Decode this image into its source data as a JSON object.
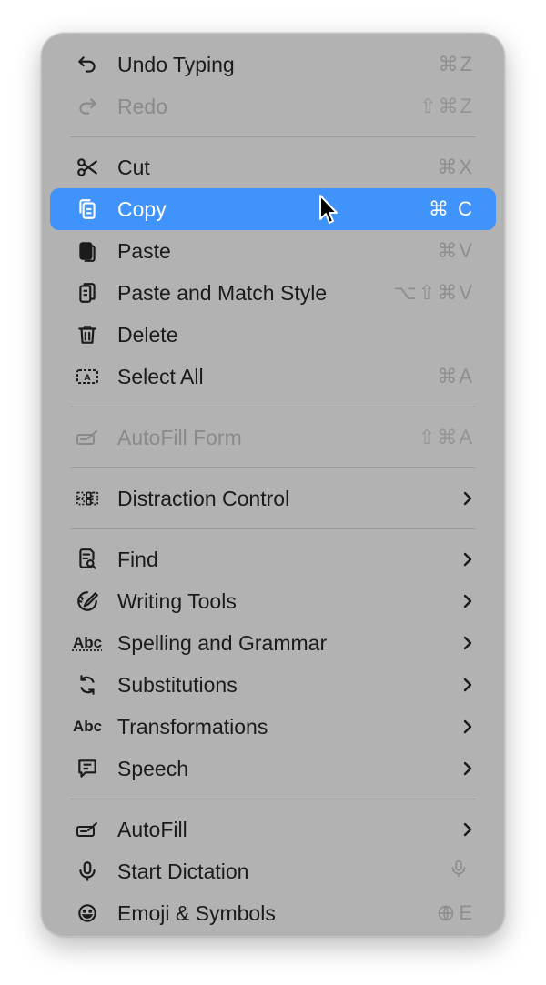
{
  "menu": {
    "edit": {
      "undo": {
        "label": "Undo Typing",
        "shortcut": "⌘Z",
        "icon": "undo-icon"
      },
      "redo": {
        "label": "Redo",
        "shortcut": "⇧⌘Z",
        "icon": "redo-icon"
      }
    },
    "clipboard": {
      "cut": {
        "label": "Cut",
        "shortcut": "⌘X",
        "icon": "scissors-icon"
      },
      "copy": {
        "label": "Copy",
        "shortcut": "⌘ C",
        "icon": "copy-icon"
      },
      "paste": {
        "label": "Paste",
        "shortcut": "⌘V",
        "icon": "paste-icon"
      },
      "paste_match": {
        "label": "Paste and Match Style",
        "shortcut": "⌥⇧⌘V",
        "icon": "paste-match-icon"
      },
      "delete": {
        "label": "Delete",
        "shortcut": "",
        "icon": "trash-icon"
      },
      "select_all": {
        "label": "Select All",
        "shortcut": "⌘A",
        "icon": "select-all-icon"
      }
    },
    "autofill_form": {
      "label": "AutoFill Form",
      "shortcut": "⇧⌘A",
      "icon": "autofill-form-icon"
    },
    "distraction": {
      "label": "Distraction Control",
      "icon": "distraction-control-icon"
    },
    "tools": {
      "find": {
        "label": "Find",
        "icon": "find-icon"
      },
      "writing_tools": {
        "label": "Writing Tools",
        "icon": "writing-tools-icon"
      },
      "spelling": {
        "label": "Spelling and Grammar",
        "icon_text": "Abc"
      },
      "substitutions": {
        "label": "Substitutions",
        "icon": "substitutions-icon"
      },
      "transformations": {
        "label": "Transformations",
        "icon_text": "Abc"
      },
      "speech": {
        "label": "Speech",
        "icon": "speech-bubble-icon"
      }
    },
    "input": {
      "autofill": {
        "label": "AutoFill",
        "icon": "autofill-icon"
      },
      "dictation": {
        "label": "Start Dictation",
        "shortcut_icon": "microphone-icon",
        "icon": "microphone-icon"
      },
      "emoji": {
        "label": "Emoji & Symbols",
        "shortcut": "E",
        "shortcut_icon": "globe-icon",
        "icon": "emoji-icon"
      }
    },
    "colors": {
      "menu_bg": "#b2b2b2",
      "highlight": "#3f93fb",
      "text": "#1b1b1b",
      "disabled": "#8a8a8a"
    }
  }
}
